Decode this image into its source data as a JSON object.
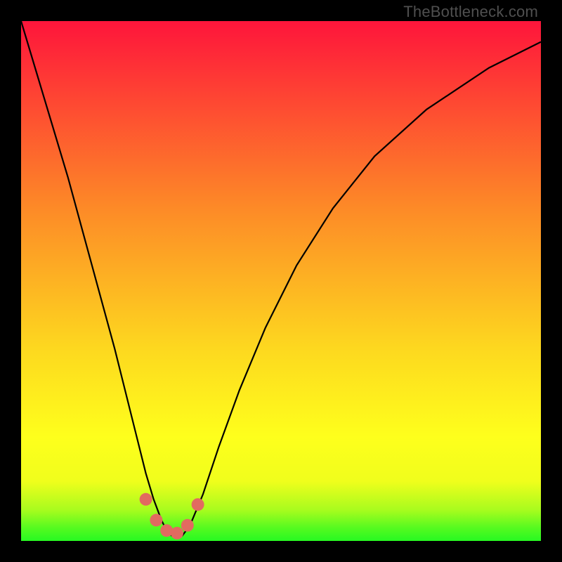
{
  "watermark": "TheBottleneck.com",
  "colors": {
    "gradient_top": "#fe153b",
    "gradient_mid1": "#fd9325",
    "gradient_mid2": "#fdf81e",
    "gradient_mid3": "#e3fb1f",
    "gradient_bottom": "#27f922",
    "curve": "#000000",
    "marker": "#e26a60",
    "frame_bg": "#000000"
  },
  "chart_data": {
    "type": "line",
    "title": "",
    "xlabel": "",
    "ylabel": "",
    "xlim": [
      0,
      100
    ],
    "ylim": [
      0,
      100
    ],
    "series": [
      {
        "name": "bottleneck-curve",
        "x": [
          0,
          3,
          6,
          9,
          12,
          15,
          18,
          20,
          22,
          24,
          25.5,
          27,
          28,
          29,
          30,
          31,
          32.5,
          35,
          38,
          42,
          47,
          53,
          60,
          68,
          78,
          90,
          100
        ],
        "y": [
          100,
          90,
          80,
          70,
          59,
          48,
          37,
          29,
          21,
          13,
          8,
          4,
          2,
          1,
          0.5,
          1,
          3,
          9,
          18,
          29,
          41,
          53,
          64,
          74,
          83,
          91,
          96
        ]
      }
    ],
    "markers": [
      {
        "x": 24.0,
        "y": 8.0
      },
      {
        "x": 26.0,
        "y": 4.0
      },
      {
        "x": 28.0,
        "y": 2.0
      },
      {
        "x": 30.0,
        "y": 1.5
      },
      {
        "x": 32.0,
        "y": 3.0
      },
      {
        "x": 34.0,
        "y": 7.0
      }
    ],
    "comment": "Values are estimated from the rendered pixels; axes are unlabeled so a 0-100 normalized domain is used."
  }
}
